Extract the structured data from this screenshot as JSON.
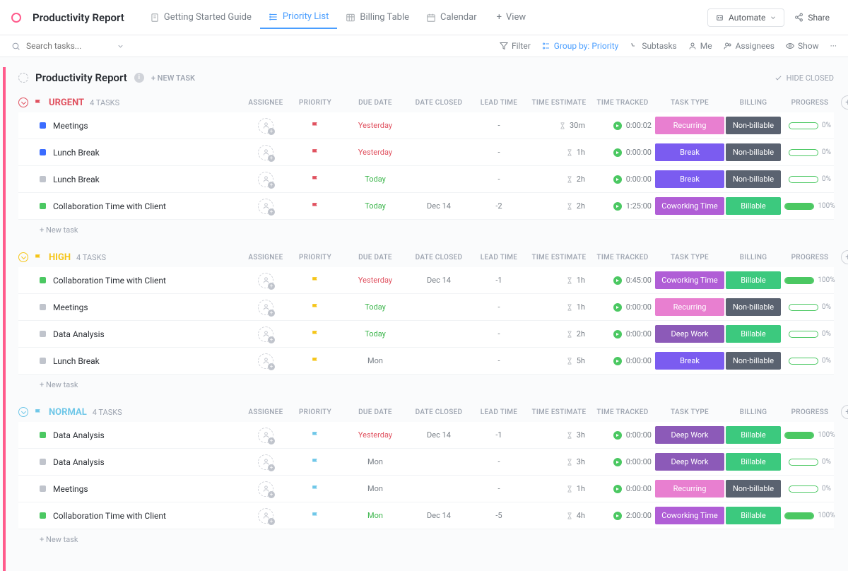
{
  "header": {
    "title": "Productivity Report",
    "tabs": [
      {
        "label": "Getting Started Guide",
        "active": false
      },
      {
        "label": "Priority List",
        "active": true
      },
      {
        "label": "Billing Table",
        "active": false
      },
      {
        "label": "Calendar",
        "active": false
      }
    ],
    "add_view": "View",
    "automate": "Automate",
    "share": "Share"
  },
  "toolbar": {
    "search_placeholder": "Search tasks...",
    "filter": "Filter",
    "group_by": "Group by: Priority",
    "subtasks": "Subtasks",
    "me": "Me",
    "assignees": "Assignees",
    "show": "Show"
  },
  "list_header": {
    "title": "Productivity Report",
    "new_task": "+ NEW TASK",
    "hide_closed": "HIDE CLOSED"
  },
  "columns": [
    "ASSIGNEE",
    "PRIORITY",
    "DUE DATE",
    "DATE CLOSED",
    "LEAD TIME",
    "TIME ESTIMATE",
    "TIME TRACKED",
    "TASK TYPE",
    "BILLING",
    "PROGRESS"
  ],
  "colors": {
    "urgent": "#e0515f",
    "high": "#f5c518",
    "normal": "#6fc7e8",
    "recurring": "#e87fd0",
    "break": "#7b5cf0",
    "coworking": "#b05ed6",
    "deepwork": "#8c5ab8",
    "billable": "#3cc97e",
    "nonbillable": "#5a6270",
    "sqBlue": "#3b6cff",
    "sqGray": "#c0c4cc",
    "sqGreen": "#4bc862"
  },
  "groups": [
    {
      "name": "URGENT",
      "count": "4 TASKS",
      "flagColor": "urgent",
      "rows": [
        {
          "sq": "sqBlue",
          "name": "Meetings",
          "due": "Yesterday",
          "dueCls": "red",
          "dc": "",
          "lt": "-",
          "te": "30m",
          "tt": "0:00:02",
          "type": "Recurring",
          "typeC": "recurring",
          "bill": "Non-billable",
          "billC": "nonbillable",
          "prog": 0
        },
        {
          "sq": "sqBlue",
          "name": "Lunch Break",
          "due": "Yesterday",
          "dueCls": "red",
          "dc": "",
          "lt": "-",
          "te": "1h",
          "tt": "0:00:00",
          "type": "Break",
          "typeC": "break",
          "bill": "Non-billable",
          "billC": "nonbillable",
          "prog": 0
        },
        {
          "sq": "sqGray",
          "name": "Lunch Break",
          "due": "Today",
          "dueCls": "green",
          "dc": "",
          "lt": "-",
          "te": "2h",
          "tt": "0:00:00",
          "type": "Break",
          "typeC": "break",
          "bill": "Non-billable",
          "billC": "nonbillable",
          "prog": 0
        },
        {
          "sq": "sqGreen",
          "name": "Collaboration Time with Client",
          "due": "Today",
          "dueCls": "green",
          "dc": "Dec 14",
          "lt": "-2",
          "te": "2h",
          "tt": "1:25:00",
          "type": "Coworking Time",
          "typeC": "coworking",
          "bill": "Billable",
          "billC": "billable",
          "prog": 100
        }
      ]
    },
    {
      "name": "HIGH",
      "count": "4 TASKS",
      "flagColor": "high",
      "rows": [
        {
          "sq": "sqGreen",
          "name": "Collaboration Time with Client",
          "due": "Yesterday",
          "dueCls": "red",
          "dc": "Dec 14",
          "lt": "-1",
          "te": "1h",
          "tt": "0:45:00",
          "type": "Coworking Time",
          "typeC": "coworking",
          "bill": "Billable",
          "billC": "billable",
          "prog": 100
        },
        {
          "sq": "sqGray",
          "name": "Meetings",
          "due": "Today",
          "dueCls": "green",
          "dc": "",
          "lt": "-",
          "te": "1h",
          "tt": "0:00:00",
          "type": "Recurring",
          "typeC": "recurring",
          "bill": "Non-billable",
          "billC": "nonbillable",
          "prog": 0
        },
        {
          "sq": "sqGray",
          "name": "Data Analysis",
          "due": "Today",
          "dueCls": "green",
          "dc": "",
          "lt": "-",
          "te": "2h",
          "tt": "0:00:00",
          "type": "Deep Work",
          "typeC": "deepwork",
          "bill": "Billable",
          "billC": "billable",
          "prog": 0
        },
        {
          "sq": "sqGray",
          "name": "Lunch Break",
          "due": "Mon",
          "dueCls": "gray",
          "dc": "",
          "lt": "-",
          "te": "5h",
          "tt": "0:00:00",
          "type": "Break",
          "typeC": "break",
          "bill": "Non-billable",
          "billC": "nonbillable",
          "prog": 0
        }
      ]
    },
    {
      "name": "NORMAL",
      "count": "4 TASKS",
      "flagColor": "normal",
      "rows": [
        {
          "sq": "sqGreen",
          "name": "Data Analysis",
          "due": "Yesterday",
          "dueCls": "red",
          "dc": "Dec 14",
          "lt": "-1",
          "te": "3h",
          "tt": "0:00:00",
          "type": "Deep Work",
          "typeC": "deepwork",
          "bill": "Billable",
          "billC": "billable",
          "prog": 100
        },
        {
          "sq": "sqGray",
          "name": "Data Analysis",
          "due": "Mon",
          "dueCls": "gray",
          "dc": "",
          "lt": "-",
          "te": "3h",
          "tt": "0:00:00",
          "type": "Deep Work",
          "typeC": "deepwork",
          "bill": "Billable",
          "billC": "billable",
          "prog": 0
        },
        {
          "sq": "sqGray",
          "name": "Meetings",
          "due": "Mon",
          "dueCls": "gray",
          "dc": "",
          "lt": "-",
          "te": "1h",
          "tt": "0:00:00",
          "type": "Recurring",
          "typeC": "recurring",
          "bill": "Non-billable",
          "billC": "nonbillable",
          "prog": 0
        },
        {
          "sq": "sqGreen",
          "name": "Collaboration Time with Client",
          "due": "Mon",
          "dueCls": "green",
          "dc": "Dec 14",
          "lt": "-5",
          "te": "4h",
          "tt": "2:00:00",
          "type": "Coworking Time",
          "typeC": "coworking",
          "bill": "Billable",
          "billC": "billable",
          "prog": 100
        }
      ]
    }
  ],
  "new_task_row": "+ New task"
}
